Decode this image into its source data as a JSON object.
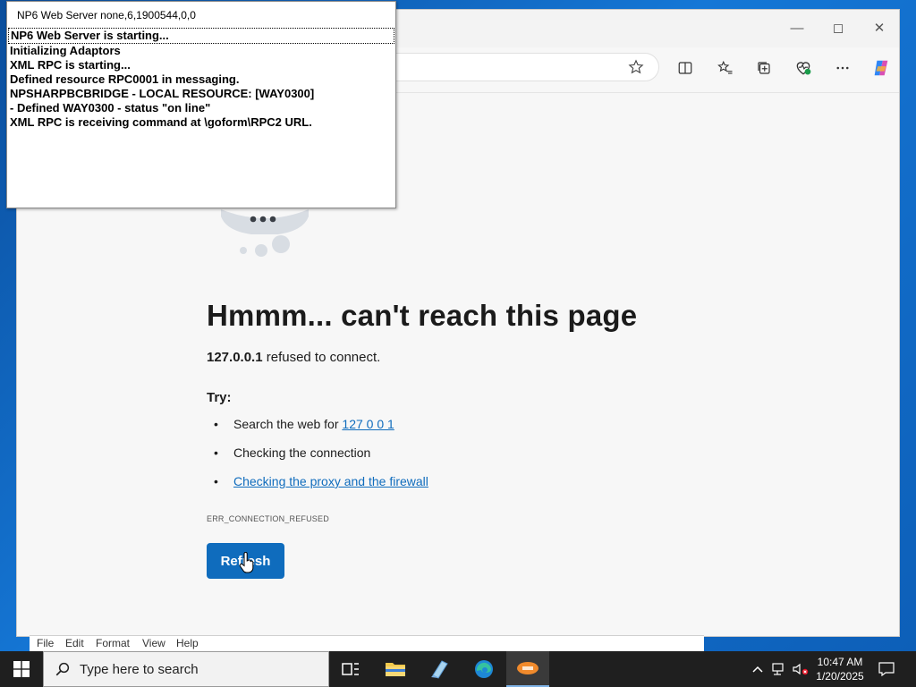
{
  "console": {
    "title": "NP6 Web Server none,6,1900544,0,0",
    "lines": [
      "NP6 Web Server is starting...",
      "Initializing Adaptors",
      "XML RPC is starting...",
      "Defined resource RPC0001 in messaging.",
      "NPSHARPBCBRIDGE - LOCAL RESOURCE: [WAY0300]",
      "- Defined WAY0300 - status \"on line\"",
      "XML RPC is receiving command at \\goform\\RPC2 URL."
    ]
  },
  "browser": {
    "error_title": "Hmmm... can't reach this page",
    "host": "127.0.0.1",
    "refused_text": " refused to connect.",
    "try_label": "Try:",
    "suggestions": {
      "search_prefix": "Search the web for ",
      "search_link": "127 0 0 1",
      "check_connection": "Checking the connection",
      "check_proxy": "Checking the proxy and the firewall"
    },
    "error_code": "ERR_CONNECTION_REFUSED",
    "refresh_label": "Refresh"
  },
  "notepad": {
    "menu": [
      "File",
      "Edit",
      "Format",
      "View",
      "Help"
    ]
  },
  "taskbar": {
    "search_placeholder": "Type here to search",
    "time": "10:47 AM",
    "date": "1/20/2025"
  },
  "colors": {
    "accent": "#0f6cbd",
    "taskbar": "#1f1f1f"
  }
}
